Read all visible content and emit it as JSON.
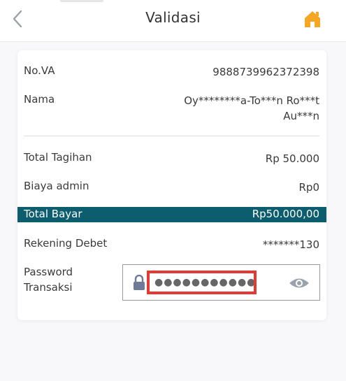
{
  "header": {
    "title": "Validasi",
    "back_icon": "chevron-left-icon",
    "home_icon": "home-icon",
    "accent_color": "#f5a623"
  },
  "details": {
    "va_label": "No.VA",
    "va_value": "9888739962372398",
    "name_label": "Nama",
    "name_line1": "Oy********a-To***n Ro***t",
    "name_line2": "Au***n",
    "tagihan_label": "Total Tagihan",
    "tagihan_value": "Rp 50.000",
    "admin_label": "Biaya admin",
    "admin_value": "Rp0",
    "total_label": "Total Bayar",
    "total_value": "Rp50.000,00",
    "total_band_color": "#0c5d6d",
    "rekening_label": "Rekening Debet",
    "rekening_value": "*******130"
  },
  "password": {
    "label_line1": "Password",
    "label_line2": "Transaksi",
    "value": "●●●●●●●●●●●●",
    "lock_icon": "lock-icon",
    "toggle_icon": "eye-icon",
    "highlight_color": "#e53935"
  }
}
